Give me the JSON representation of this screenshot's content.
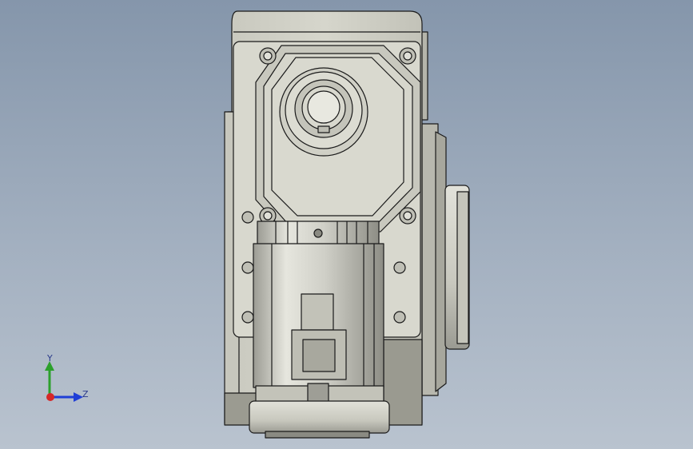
{
  "view": {
    "model": "gear-motor-assembly",
    "background_top": "#8596ab",
    "background_bottom": "#b9c3cf",
    "part_color": "#d2d2c8",
    "part_shade": "#a9a99f",
    "edge_color": "#1a1a1a"
  },
  "triad": {
    "y_label": "Y",
    "z_label": "Z",
    "y_color": "#2ca02c",
    "z_color": "#1f3fd6",
    "x_color": "#d62728"
  }
}
